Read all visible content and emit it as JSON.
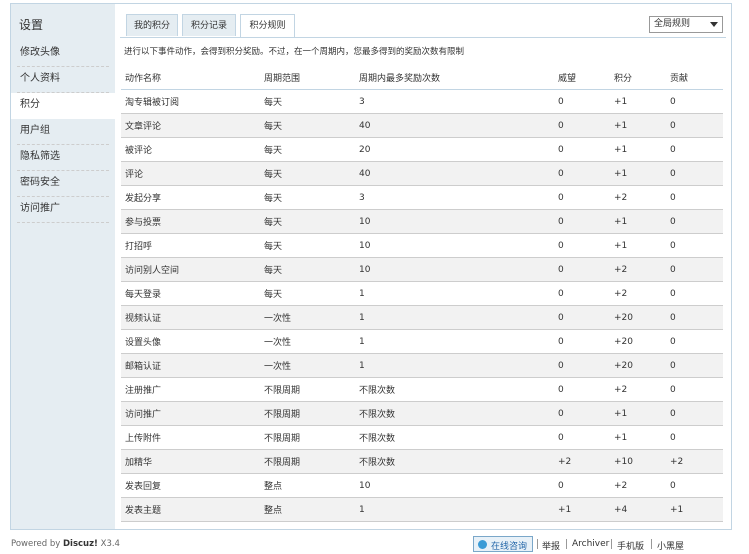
{
  "sidebar": {
    "title": "设置",
    "items": [
      {
        "label": "修改头像"
      },
      {
        "label": "个人资料"
      },
      {
        "label": "积分"
      },
      {
        "label": "用户组"
      },
      {
        "label": "隐私筛选"
      },
      {
        "label": "密码安全"
      },
      {
        "label": "访问推广"
      }
    ],
    "active_index": 2
  },
  "tabs": [
    {
      "label": "我的积分"
    },
    {
      "label": "积分记录"
    },
    {
      "label": "积分规则"
    }
  ],
  "active_tab": 2,
  "scope_select": {
    "value": "全局规则"
  },
  "note": "进行以下事件动作，会得到积分奖励。不过，在一个周期内，您最多得到的奖励次数有限制",
  "table": {
    "headers": [
      "动作名称",
      "周期范围",
      "周期内最多奖励次数",
      "威望",
      "积分",
      "贡献"
    ],
    "rows": [
      [
        "淘专辑被订阅",
        "每天",
        "3",
        "0",
        "+1",
        "0"
      ],
      [
        "文章评论",
        "每天",
        "40",
        "0",
        "+1",
        "0"
      ],
      [
        "被评论",
        "每天",
        "20",
        "0",
        "+1",
        "0"
      ],
      [
        "评论",
        "每天",
        "40",
        "0",
        "+1",
        "0"
      ],
      [
        "发起分享",
        "每天",
        "3",
        "0",
        "+2",
        "0"
      ],
      [
        "参与投票",
        "每天",
        "10",
        "0",
        "+1",
        "0"
      ],
      [
        "打招呼",
        "每天",
        "10",
        "0",
        "+1",
        "0"
      ],
      [
        "访问别人空间",
        "每天",
        "10",
        "0",
        "+2",
        "0"
      ],
      [
        "每天登录",
        "每天",
        "1",
        "0",
        "+2",
        "0"
      ],
      [
        "视频认证",
        "一次性",
        "1",
        "0",
        "+20",
        "0"
      ],
      [
        "设置头像",
        "一次性",
        "1",
        "0",
        "+20",
        "0"
      ],
      [
        "邮箱认证",
        "一次性",
        "1",
        "0",
        "+20",
        "0"
      ],
      [
        "注册推广",
        "不限周期",
        "不限次数",
        "0",
        "+2",
        "0"
      ],
      [
        "访问推广",
        "不限周期",
        "不限次数",
        "0",
        "+1",
        "0"
      ],
      [
        "上传附件",
        "不限周期",
        "不限次数",
        "0",
        "+1",
        "0"
      ],
      [
        "加精华",
        "不限周期",
        "不限次数",
        "+2",
        "+10",
        "+2"
      ],
      [
        "发表回复",
        "整点",
        "10",
        "0",
        "+2",
        "0"
      ],
      [
        "发表主题",
        "整点",
        "1",
        "+1",
        "+4",
        "+1"
      ]
    ]
  },
  "footer": {
    "powered_prefix": "Powered by ",
    "powered_brand": "Discuz!",
    "version": " X3.4",
    "consult_label": "在线咨询",
    "links": [
      "举报",
      "Archiver",
      "手机版",
      "小黑屋"
    ]
  }
}
